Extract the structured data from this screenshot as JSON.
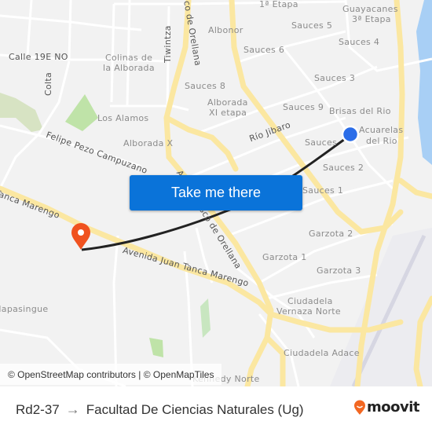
{
  "map": {
    "attribution": "© OpenStreetMap contributors | © OpenMapTiles",
    "colors": {
      "background": "#f2f2f2",
      "road_major": "#fbe7a1",
      "road_minor": "#ffffff",
      "park": "#bfe3a8",
      "water": "#a8cff5",
      "route_line": "#222222",
      "origin_marker": "#2b6de8",
      "destination_marker": "#f0521f"
    },
    "labels": {
      "etapa1": "1ª Etapa",
      "guayacanes": "Guayacanes",
      "guayacanes2": "3ª Etapa",
      "albonor": "Albonor",
      "sauces5": "Sauces 5",
      "sauces4": "Sauces 4",
      "sauces6": "Sauces 6",
      "sauces3": "Sauces 3",
      "sauces8": "Sauces 8",
      "sauces9": "Sauces 9",
      "brisas": "Brisas del Rio",
      "alborada_xi_1": "Alborada",
      "alborada_xi_2": "XI etapa",
      "acuarelas1": "Acuarelas",
      "acuarelas2": "del Rio",
      "rio_jibaro": "Río Jibaro",
      "sauces_partial": "Sauces",
      "sauces2": "Sauces 2",
      "sauces1": "Sauces 1",
      "calle19e": "Calle 19E NO",
      "colinas1": "Colinas de",
      "colinas2": "la Alborada",
      "colta": "Colta",
      "tiwintza": "Tiwintza",
      "orellana_top": "co de Orellana",
      "los_alamos": "Los Alamos",
      "alborada_x": "Alborada X",
      "felipe": "Felipe Pezo Campuzano",
      "tanca_west": "Tanca Marengo",
      "av_juan_tanca": "Avenida Juan Tanca Marengo",
      "francisco_orellana": "Av. Francisco de Orellana",
      "garzota2": "Garzota 2",
      "garzota1": "Garzota 1",
      "garzota3": "Garzota 3",
      "vernaza1": "Ciudadela",
      "vernaza2": "Vernaza Norte",
      "adace": "Ciudadela Adace",
      "kennedy": "Kennedy Norte",
      "mapasingue": "Mapasingue"
    }
  },
  "cta": {
    "label": "Take me there",
    "color": "#0a73d9"
  },
  "route": {
    "origin": "Rd2-37",
    "arrow": "→",
    "destination": "Facultad De Ciencias Naturales (Ug)"
  },
  "brand": {
    "name": "moovit",
    "color": "#f26722"
  }
}
